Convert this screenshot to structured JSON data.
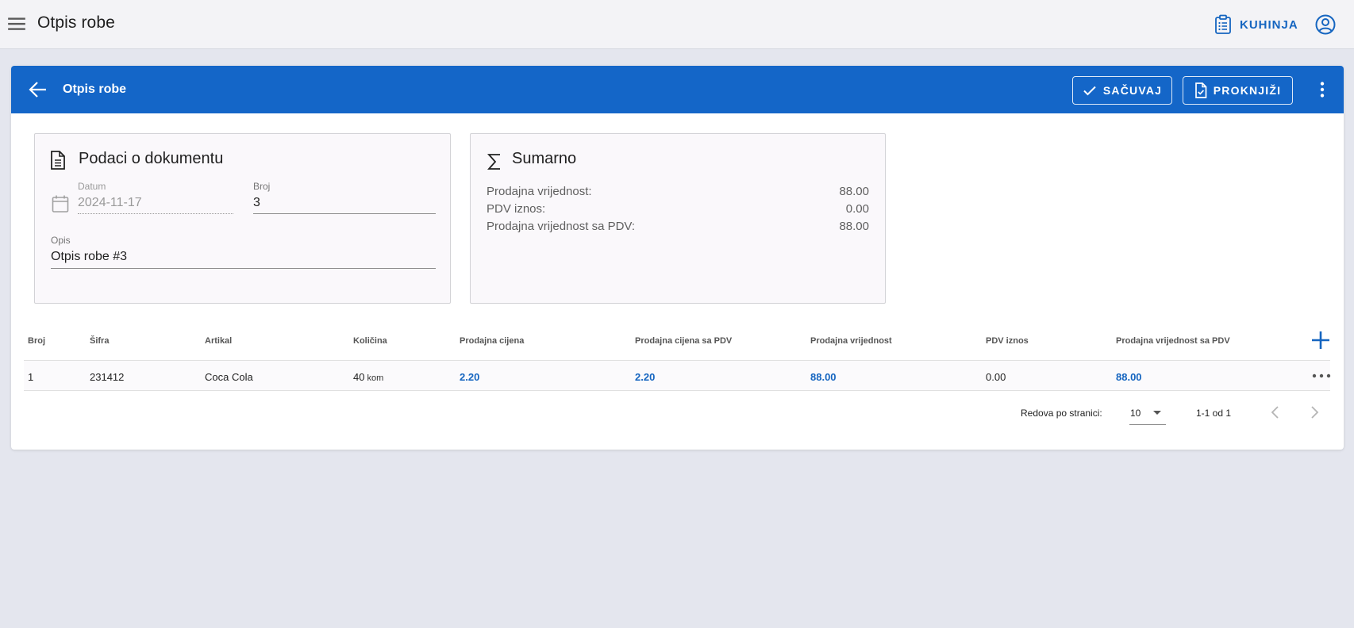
{
  "appbar": {
    "title": "Otpis robe",
    "kitchen_label": "KUHINJA",
    "icons": {
      "menu": "menu-icon",
      "kitchen": "clipboard-list-icon",
      "account": "account-circle-icon"
    }
  },
  "header": {
    "title": "Otpis robe",
    "save_label": "SAČUVAJ",
    "post_label": "PROKNJIŽI",
    "color": "#1466c8"
  },
  "document": {
    "title": "Podaci o dokumentu",
    "date_label": "Datum",
    "date_value": "2024-11-17",
    "number_label": "Broj",
    "number_value": "3",
    "description_label": "Opis",
    "description_value": "Otpis robe #3"
  },
  "summary": {
    "title": "Sumarno",
    "rows": [
      {
        "label": "Prodajna vrijednost:",
        "value": "88.00"
      },
      {
        "label": "PDV iznos:",
        "value": "0.00"
      },
      {
        "label": "Prodajna vrijednost sa PDV:",
        "value": "88.00"
      }
    ]
  },
  "table": {
    "headers": [
      "Broj",
      "Šifra",
      "Artikal",
      "Količina",
      "Prodajna cijena",
      "Prodajna cijena sa PDV",
      "Prodajna vrijednost",
      "PDV iznos",
      "Prodajna vrijednost sa PDV"
    ],
    "rows": [
      {
        "broj": "1",
        "sifra": "231412",
        "artikal": "Coca Cola",
        "kolicina": "40",
        "unit": "kom",
        "prodajna_cijena": "2.20",
        "prodajna_cijena_pdv": "2.20",
        "prodajna_vrijednost": "88.00",
        "pdv_iznos": "0.00",
        "prodajna_vrijednost_pdv": "88.00"
      }
    ],
    "link_color": "#1565c0"
  },
  "pagination": {
    "rows_per_page_label": "Redova po stranici:",
    "rows_per_page": "10",
    "range": "1-1 od 1"
  }
}
